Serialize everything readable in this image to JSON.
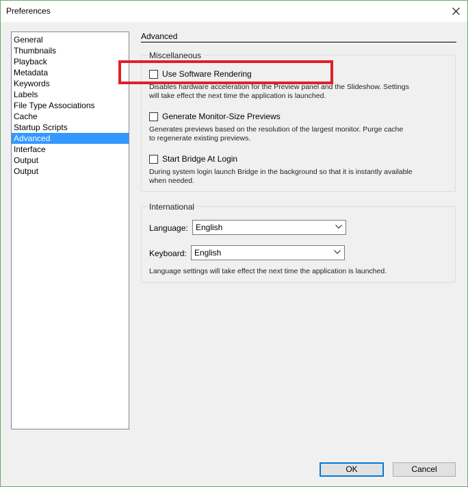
{
  "window": {
    "title": "Preferences"
  },
  "sidebar": {
    "items": [
      {
        "label": "General"
      },
      {
        "label": "Thumbnails"
      },
      {
        "label": "Playback"
      },
      {
        "label": "Metadata"
      },
      {
        "label": "Keywords"
      },
      {
        "label": "Labels"
      },
      {
        "label": "File Type Associations"
      },
      {
        "label": "Cache"
      },
      {
        "label": "Startup Scripts"
      },
      {
        "label": "Advanced",
        "selected": true
      },
      {
        "label": "Interface"
      },
      {
        "label": "Output"
      },
      {
        "label": "Output"
      }
    ]
  },
  "panel": {
    "heading": "Advanced",
    "miscellaneous": {
      "title": "Miscellaneous",
      "options": [
        {
          "label": "Use Software Rendering",
          "checked": false,
          "desc_line1": "Disables hardware acceleration for the Preview panel and the Slideshow. Settings",
          "desc_line2": "will take effect the next time the application is launched."
        },
        {
          "label": "Generate Monitor-Size Previews",
          "checked": false,
          "desc_line1": "Generates previews based on the resolution of the largest monitor.  Purge cache",
          "desc_line2": "to regenerate existing previews."
        },
        {
          "label": "Start Bridge At Login",
          "checked": false,
          "desc_line1": "During system login launch Bridge in the background so that it is instantly available",
          "desc_line2": "when needed."
        }
      ]
    },
    "international": {
      "title": "International",
      "language_label": "Language:",
      "language_value": "English",
      "keyboard_label": "Keyboard:",
      "keyboard_value": "English",
      "note": "Language settings will take effect the next time the application is launched."
    }
  },
  "buttons": {
    "ok": "OK",
    "cancel": "Cancel"
  },
  "colors": {
    "selection": "#3399ff",
    "highlight": "#e0202a",
    "default_button_border": "#0078d7"
  }
}
